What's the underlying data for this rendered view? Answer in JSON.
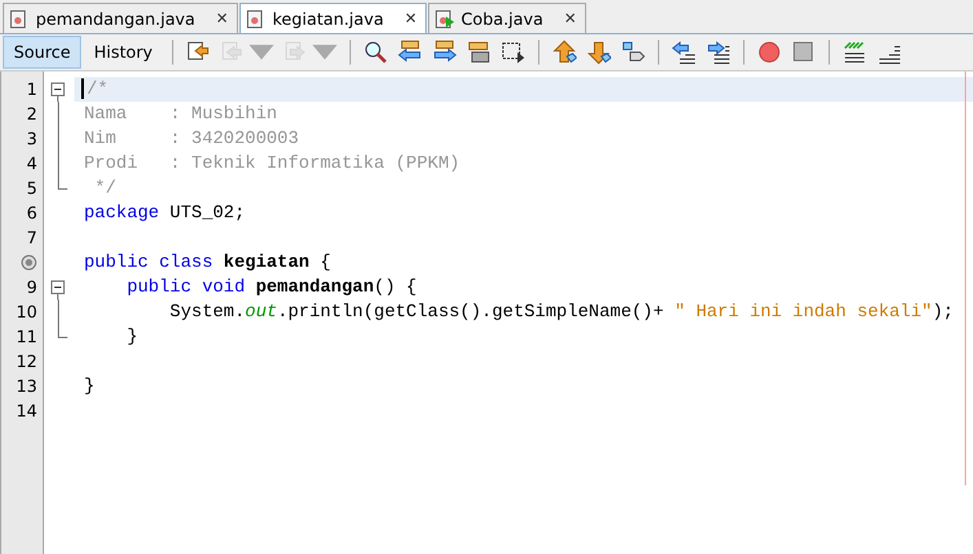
{
  "tabs": [
    {
      "label": "pemandangan.java",
      "kind": "file",
      "close": "✕",
      "selected": false
    },
    {
      "label": "kegiatan.java",
      "kind": "file",
      "close": "✕",
      "selected": true
    },
    {
      "label": "Coba.java",
      "kind": "runnable",
      "close": "✕",
      "selected": false
    }
  ],
  "views": [
    {
      "label": "Source",
      "selected": true
    },
    {
      "label": "History",
      "selected": false
    }
  ],
  "toolbar": [
    {
      "kind": "last-edit",
      "disabled": false
    },
    {
      "kind": "back",
      "disabled": true
    },
    {
      "kind": "forward",
      "disabled": true
    },
    {
      "kind": "separator"
    },
    {
      "kind": "find",
      "disabled": false
    },
    {
      "kind": "find-prev",
      "disabled": false
    },
    {
      "kind": "find-next",
      "disabled": false
    },
    {
      "kind": "highlight",
      "disabled": false
    },
    {
      "kind": "select",
      "disabled": false
    },
    {
      "kind": "separator"
    },
    {
      "kind": "bookmark-prev",
      "disabled": false
    },
    {
      "kind": "bookmark-next",
      "disabled": false
    },
    {
      "kind": "bookmark",
      "disabled": false
    },
    {
      "kind": "separator"
    },
    {
      "kind": "shift-left",
      "disabled": false
    },
    {
      "kind": "shift-right",
      "disabled": false
    },
    {
      "kind": "separator"
    },
    {
      "kind": "record",
      "disabled": false
    },
    {
      "kind": "stop",
      "disabled": false
    },
    {
      "kind": "separator"
    },
    {
      "kind": "comment",
      "disabled": false
    },
    {
      "kind": "uncomment",
      "disabled": false
    }
  ],
  "lines": [
    {
      "number": "1",
      "kind": "fold-start",
      "current": true,
      "marker": false,
      "tokens": [
        {
          "text": "/*",
          "kind": "comment"
        }
      ]
    },
    {
      "number": "2",
      "kind": "fold-body",
      "current": false,
      "marker": false,
      "tokens": [
        {
          "text": "Nama    : Musbihin",
          "kind": "comment"
        }
      ]
    },
    {
      "number": "3",
      "kind": "fold-body",
      "current": false,
      "marker": false,
      "tokens": [
        {
          "text": "Nim     : 3420200003",
          "kind": "comment"
        }
      ]
    },
    {
      "number": "4",
      "kind": "fold-body",
      "current": false,
      "marker": false,
      "tokens": [
        {
          "text": "Prodi   : Teknik Informatika (PPKM)",
          "kind": "comment"
        }
      ]
    },
    {
      "number": "5",
      "kind": "fold-end",
      "current": false,
      "marker": false,
      "tokens": [
        {
          "text": " */",
          "kind": "comment"
        }
      ]
    },
    {
      "number": "6",
      "kind": "plain",
      "current": false,
      "marker": false,
      "tokens": [
        {
          "text": "package",
          "kind": "keyword"
        },
        {
          "text": " UTS_02;",
          "kind": "plain"
        }
      ]
    },
    {
      "number": "7",
      "kind": "plain",
      "current": false,
      "marker": false
    },
    {
      "kind": "plain",
      "current": false,
      "marker": true,
      "tokens": [
        {
          "text": "public class ",
          "kind": "keyword"
        },
        {
          "text": "kegiatan",
          "kind": "bold"
        },
        {
          "text": " {",
          "kind": "plain"
        }
      ]
    },
    {
      "number": "9",
      "kind": "fold-start",
      "current": false,
      "marker": false,
      "tokens": [
        {
          "text": "    public void ",
          "kind": "keyword"
        },
        {
          "text": "pemandangan",
          "kind": "bold"
        },
        {
          "text": "() {",
          "kind": "plain"
        }
      ]
    },
    {
      "number": "10",
      "kind": "fold-body",
      "current": false,
      "marker": false,
      "tokens": [
        {
          "text": "        System.",
          "kind": "plain"
        },
        {
          "text": "out",
          "kind": "field"
        },
        {
          "text": ".println(getClass().getSimpleName()+ ",
          "kind": "plain"
        },
        {
          "text": "\" Hari ini indah sekali\"",
          "kind": "string"
        },
        {
          "text": ");",
          "kind": "plain"
        }
      ]
    },
    {
      "number": "11",
      "kind": "fold-end",
      "current": false,
      "marker": false,
      "tokens": [
        {
          "text": "    }",
          "kind": "plain"
        }
      ]
    },
    {
      "number": "12",
      "kind": "plain",
      "current": false,
      "marker": false
    },
    {
      "number": "13",
      "kind": "plain",
      "current": false,
      "marker": false,
      "tokens": [
        {
          "text": "}",
          "kind": "plain"
        }
      ]
    },
    {
      "number": "14",
      "kind": "plain",
      "current": false,
      "marker": false
    }
  ]
}
